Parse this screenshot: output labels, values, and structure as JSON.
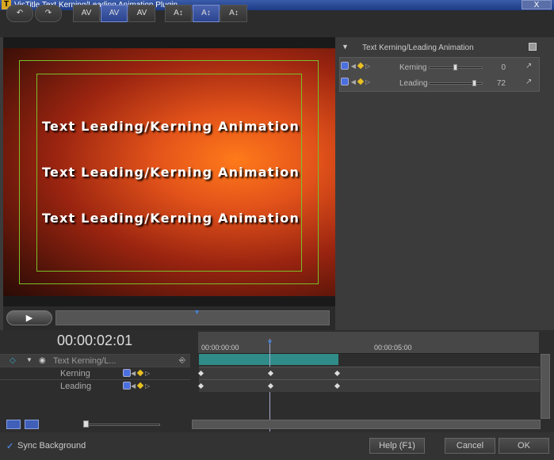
{
  "window": {
    "title": "VisTitle Text Kerning/Leading Animation Plugin",
    "close_label": "X"
  },
  "toolbar": {
    "undo_icon": "undo-icon",
    "redo_icon": "redo-icon",
    "kerning_buttons": [
      "AV",
      "AV",
      "AV"
    ],
    "leading_buttons": [
      "A↕",
      "A↕",
      "A↕"
    ]
  },
  "preview": {
    "lines": [
      "Text Leading/Kerning Animation",
      "Text Leading/Kerning Animation",
      "Text Leading/Kerning Animation"
    ]
  },
  "properties": {
    "header": "Text Kerning/Leading Animation",
    "rows": [
      {
        "label": "Kerning",
        "value": "0",
        "level": 0.5
      },
      {
        "label": "Leading",
        "value": "72",
        "level": 0.85
      }
    ]
  },
  "timeline": {
    "timecode": "00:00:02:01",
    "ruler_labels": [
      "00:00:00:00",
      "00:00:05:00"
    ],
    "track_name": "Text Kerning/L...",
    "sub_tracks": [
      "Kerning",
      "Leading"
    ]
  },
  "footer": {
    "sync_label": "Sync Background",
    "sync_checked": true,
    "help_label": "Help (F1)",
    "cancel_label": "Cancel",
    "ok_label": "OK"
  }
}
